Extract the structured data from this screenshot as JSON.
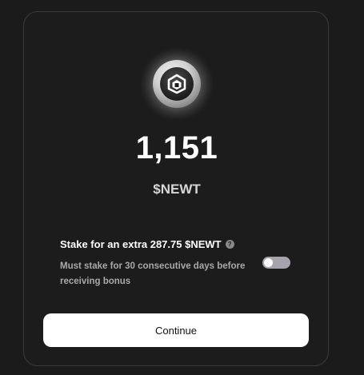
{
  "token": {
    "logo_icon": "newton-hexagon-logo-icon",
    "amount": "1,151",
    "ticker": "$NEWT"
  },
  "stake_option": {
    "title": "Stake for an extra 287.75 $NEWT",
    "help_icon": "question-circle-icon",
    "help_glyph": "?",
    "description": "Must stake for 30 consecutive days before receiving bonus",
    "toggle_on": false
  },
  "actions": {
    "continue_label": "Continue"
  },
  "colors": {
    "background": "#1b1b1b",
    "card_border": "#3a3a3a",
    "toggle_off": "#a6a3ad",
    "button_bg": "#ffffff"
  }
}
